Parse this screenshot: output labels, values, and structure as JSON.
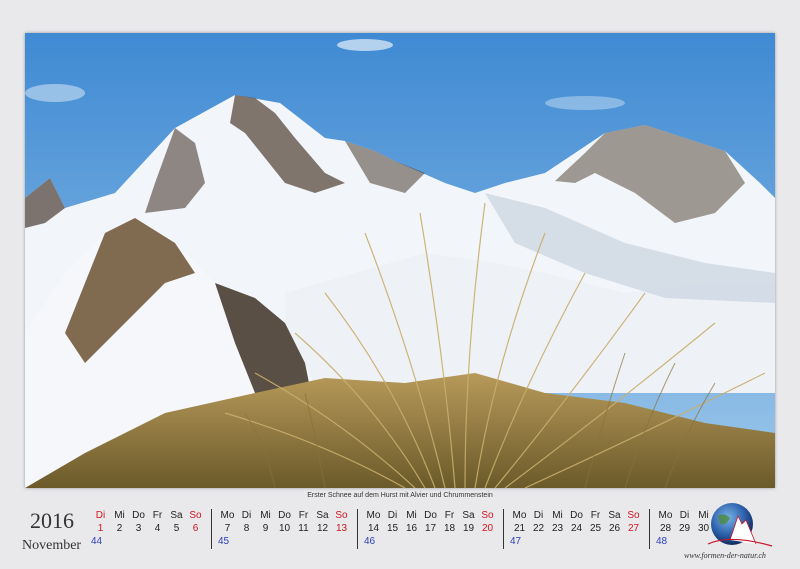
{
  "photo": {
    "caption": "Erster Schnee auf dem Hurst mit Alvier und Chrummenstein"
  },
  "calendar": {
    "year": "2016",
    "month": "November",
    "weeks": [
      {
        "number": "44",
        "days": [
          {
            "name": "Di",
            "date": "1",
            "weekend": true
          },
          {
            "name": "Mi",
            "date": "2",
            "weekend": false
          },
          {
            "name": "Do",
            "date": "3",
            "weekend": false
          },
          {
            "name": "Fr",
            "date": "4",
            "weekend": false
          },
          {
            "name": "Sa",
            "date": "5",
            "weekend": false
          },
          {
            "name": "So",
            "date": "6",
            "weekend": true
          }
        ]
      },
      {
        "number": "45",
        "days": [
          {
            "name": "Mo",
            "date": "7",
            "weekend": false
          },
          {
            "name": "Di",
            "date": "8",
            "weekend": false
          },
          {
            "name": "Mi",
            "date": "9",
            "weekend": false
          },
          {
            "name": "Do",
            "date": "10",
            "weekend": false
          },
          {
            "name": "Fr",
            "date": "11",
            "weekend": false
          },
          {
            "name": "Sa",
            "date": "12",
            "weekend": false
          },
          {
            "name": "So",
            "date": "13",
            "weekend": true
          }
        ]
      },
      {
        "number": "46",
        "days": [
          {
            "name": "Mo",
            "date": "14",
            "weekend": false
          },
          {
            "name": "Di",
            "date": "15",
            "weekend": false
          },
          {
            "name": "Mi",
            "date": "16",
            "weekend": false
          },
          {
            "name": "Do",
            "date": "17",
            "weekend": false
          },
          {
            "name": "Fr",
            "date": "18",
            "weekend": false
          },
          {
            "name": "Sa",
            "date": "19",
            "weekend": false
          },
          {
            "name": "So",
            "date": "20",
            "weekend": true
          }
        ]
      },
      {
        "number": "47",
        "days": [
          {
            "name": "Mo",
            "date": "21",
            "weekend": false
          },
          {
            "name": "Di",
            "date": "22",
            "weekend": false
          },
          {
            "name": "Mi",
            "date": "23",
            "weekend": false
          },
          {
            "name": "Do",
            "date": "24",
            "weekend": false
          },
          {
            "name": "Fr",
            "date": "25",
            "weekend": false
          },
          {
            "name": "Sa",
            "date": "26",
            "weekend": false
          },
          {
            "name": "So",
            "date": "27",
            "weekend": true
          }
        ]
      },
      {
        "number": "48",
        "days": [
          {
            "name": "Mo",
            "date": "28",
            "weekend": false
          },
          {
            "name": "Di",
            "date": "29",
            "weekend": false
          },
          {
            "name": "Mi",
            "date": "30",
            "weekend": false
          }
        ]
      }
    ]
  },
  "branding": {
    "url": "www.formen-der-natur.ch",
    "logo_icon": "globe-mountain-icon"
  },
  "colors": {
    "weekend_red": "#d2141e",
    "week_number_blue": "#2a40b8",
    "sky": "#4f97d6"
  }
}
